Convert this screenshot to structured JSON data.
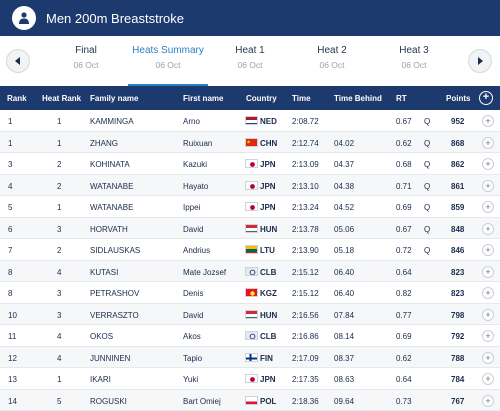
{
  "header": {
    "title": "Men 200m Breaststroke"
  },
  "tabs": [
    {
      "name": "Final",
      "date": "06 Oct",
      "active": false
    },
    {
      "name": "Heats Summary",
      "date": "06 Oct",
      "active": true
    },
    {
      "name": "Heat 1",
      "date": "06 Oct",
      "active": false
    },
    {
      "name": "Heat 2",
      "date": "06 Oct",
      "active": false
    },
    {
      "name": "Heat 3",
      "date": "06 Oct",
      "active": false
    }
  ],
  "columns": {
    "rank": "Rank",
    "heat_rank": "Heat Rank",
    "family_name": "Family name",
    "first_name": "First name",
    "country": "Country",
    "time": "Time",
    "time_behind": "Time Behind",
    "rt": "RT",
    "points": "Points"
  },
  "colors": {
    "header_bg": "#1d3a6e",
    "active_tab": "#2c7fc4"
  },
  "rows": [
    {
      "rank": "1",
      "heat_rank": "1",
      "family": "KAMMINGA",
      "first": "Arno",
      "country": "NED",
      "flag": "ned",
      "time": "2:08.72",
      "behind": "",
      "rt": "0.67",
      "q": "Q",
      "points": "952"
    },
    {
      "rank": "1",
      "heat_rank": "1",
      "family": "ZHANG",
      "first": "Ruixuan",
      "country": "CHN",
      "flag": "chn",
      "time": "2:12.74",
      "behind": "04.02",
      "rt": "0.62",
      "q": "Q",
      "points": "868"
    },
    {
      "rank": "3",
      "heat_rank": "2",
      "family": "KOHINATA",
      "first": "Kazuki",
      "country": "JPN",
      "flag": "jpn",
      "time": "2:13.09",
      "behind": "04.37",
      "rt": "0.68",
      "q": "Q",
      "points": "862"
    },
    {
      "rank": "4",
      "heat_rank": "2",
      "family": "WATANABE",
      "first": "Hayato",
      "country": "JPN",
      "flag": "jpn",
      "time": "2:13.10",
      "behind": "04.38",
      "rt": "0.71",
      "q": "Q",
      "points": "861"
    },
    {
      "rank": "5",
      "heat_rank": "1",
      "family": "WATANABE",
      "first": "Ippei",
      "country": "JPN",
      "flag": "jpn",
      "time": "2:13.24",
      "behind": "04.52",
      "rt": "0.69",
      "q": "Q",
      "points": "859"
    },
    {
      "rank": "6",
      "heat_rank": "3",
      "family": "HORVATH",
      "first": "David",
      "country": "HUN",
      "flag": "hun",
      "time": "2:13.78",
      "behind": "05.06",
      "rt": "0.67",
      "q": "Q",
      "points": "848"
    },
    {
      "rank": "7",
      "heat_rank": "2",
      "family": "SIDLAUSKAS",
      "first": "Andrius",
      "country": "LTU",
      "flag": "ltu",
      "time": "2:13.90",
      "behind": "05.18",
      "rt": "0.72",
      "q": "Q",
      "points": "846"
    },
    {
      "rank": "8",
      "heat_rank": "4",
      "family": "KUTASI",
      "first": "Mate Jozsef",
      "country": "CLB",
      "flag": "clb",
      "time": "2:15.12",
      "behind": "06.40",
      "rt": "0.64",
      "q": "",
      "points": "823"
    },
    {
      "rank": "8",
      "heat_rank": "3",
      "family": "PETRASHOV",
      "first": "Denis",
      "country": "KGZ",
      "flag": "kgz",
      "time": "2:15.12",
      "behind": "06.40",
      "rt": "0.82",
      "q": "",
      "points": "823"
    },
    {
      "rank": "10",
      "heat_rank": "3",
      "family": "VERRASZTO",
      "first": "David",
      "country": "HUN",
      "flag": "hun",
      "time": "2:16.56",
      "behind": "07.84",
      "rt": "0.77",
      "q": "",
      "points": "798"
    },
    {
      "rank": "11",
      "heat_rank": "4",
      "family": "OKOS",
      "first": "Akos",
      "country": "CLB",
      "flag": "clb",
      "time": "2:16.86",
      "behind": "08.14",
      "rt": "0.69",
      "q": "",
      "points": "792"
    },
    {
      "rank": "12",
      "heat_rank": "4",
      "family": "JUNNINEN",
      "first": "Tapio",
      "country": "FIN",
      "flag": "fin",
      "time": "2:17.09",
      "behind": "08.37",
      "rt": "0.62",
      "q": "",
      "points": "788"
    },
    {
      "rank": "13",
      "heat_rank": "1",
      "family": "IKARI",
      "first": "Yuki",
      "country": "JPN",
      "flag": "jpn",
      "time": "2:17.35",
      "behind": "08.63",
      "rt": "0.64",
      "q": "",
      "points": "784"
    },
    {
      "rank": "14",
      "heat_rank": "5",
      "family": "ROGUSKI",
      "first": "Bart Omiej",
      "country": "POL",
      "flag": "pol",
      "time": "2:18.36",
      "behind": "09.64",
      "rt": "0.73",
      "q": "",
      "points": "767"
    }
  ]
}
